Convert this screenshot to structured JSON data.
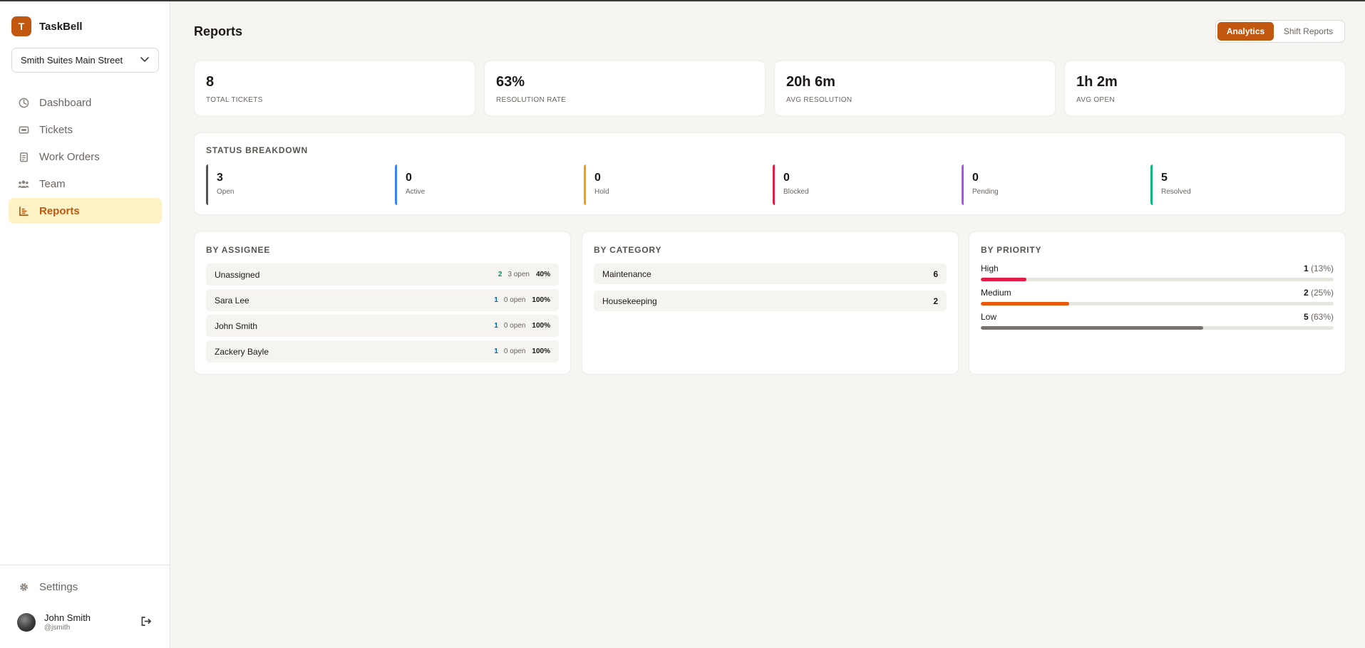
{
  "brand": {
    "logo_letter": "T",
    "name": "TaskBell"
  },
  "location": {
    "selected": "Smith Suites Main Street"
  },
  "nav": [
    {
      "label": "Dashboard",
      "icon": "dashboard-icon",
      "active": false
    },
    {
      "label": "Tickets",
      "icon": "ticket-icon",
      "active": false
    },
    {
      "label": "Work Orders",
      "icon": "clipboard-icon",
      "active": false
    },
    {
      "label": "Team",
      "icon": "team-icon",
      "active": false
    },
    {
      "label": "Reports",
      "icon": "chart-icon",
      "active": true
    }
  ],
  "settings_label": "Settings",
  "user": {
    "name": "John Smith",
    "handle": "@jsmith"
  },
  "page": {
    "title": "Reports",
    "toggle": {
      "active": "Analytics",
      "inactive": "Shift Reports"
    }
  },
  "kpis": [
    {
      "value": "8",
      "label": "TOTAL TICKETS"
    },
    {
      "value": "63%",
      "label": "RESOLUTION RATE"
    },
    {
      "value": "20h 6m",
      "label": "AVG RESOLUTION"
    },
    {
      "value": "1h 2m",
      "label": "AVG OPEN"
    }
  ],
  "status_breakdown": {
    "title": "STATUS BREAKDOWN",
    "items": [
      {
        "count": "3",
        "label": "Open",
        "color": "#57534e"
      },
      {
        "count": "0",
        "label": "Active",
        "color": "#3b82f6"
      },
      {
        "count": "0",
        "label": "Hold",
        "color": "#f59e0b"
      },
      {
        "count": "0",
        "label": "Blocked",
        "color": "#e11d48"
      },
      {
        "count": "0",
        "label": "Pending",
        "color": "#a855f7"
      },
      {
        "count": "5",
        "label": "Resolved",
        "color": "#10b981"
      }
    ]
  },
  "by_assignee": {
    "title": "BY ASSIGNEE",
    "rows": [
      {
        "name": "Unassigned",
        "count": "2",
        "open": "3 open",
        "pct": "40%"
      },
      {
        "name": "Sara Lee",
        "count": "1",
        "open": "0 open",
        "pct": "100%"
      },
      {
        "name": "John Smith",
        "count": "1",
        "open": "0 open",
        "pct": "100%"
      },
      {
        "name": "Zackery Bayle",
        "count": "1",
        "open": "0 open",
        "pct": "100%"
      }
    ]
  },
  "by_category": {
    "title": "BY CATEGORY",
    "rows": [
      {
        "name": "Maintenance",
        "value": "6"
      },
      {
        "name": "Housekeeping",
        "value": "2"
      }
    ]
  },
  "by_priority": {
    "title": "BY PRIORITY",
    "rows": [
      {
        "name": "High",
        "count": "1",
        "pct_text": "(13%)",
        "fraction": 0.13,
        "color": "#e11d48"
      },
      {
        "name": "Medium",
        "count": "2",
        "pct_text": "(25%)",
        "fraction": 0.25,
        "color": "#ea580c"
      },
      {
        "name": "Low",
        "count": "5",
        "pct_text": "(63%)",
        "fraction": 0.63,
        "color": "#78716c"
      }
    ]
  }
}
